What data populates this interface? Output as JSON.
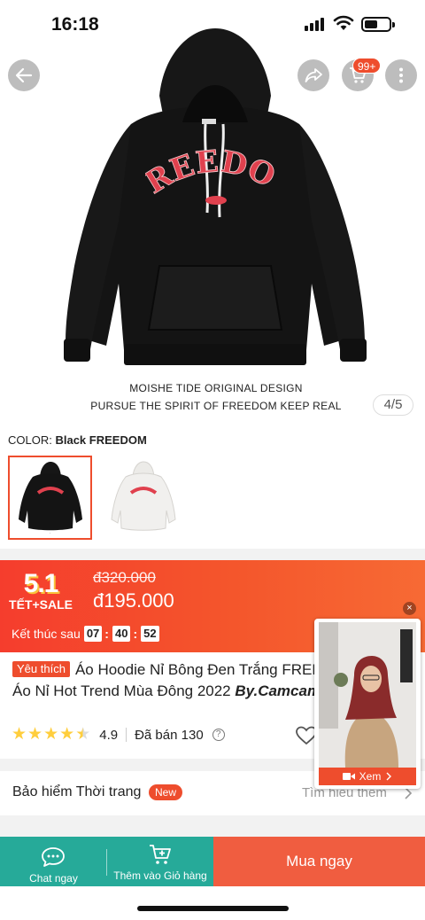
{
  "status_bar": {
    "time": "16:18"
  },
  "hero": {
    "cart_badge": "99+",
    "garment_print": "FREEDOM",
    "caption_line1": "MOISHE TIDE ORIGINAL DESIGN",
    "caption_line2": "PURSUE THE SPIRIT OF FREEDOM KEEP REAL",
    "image_counter": "4/5"
  },
  "color": {
    "label": "COLOR:",
    "selected": "Black FREEDOM"
  },
  "sale": {
    "logo_top": "5.1",
    "logo_bottom": "TẾT+SALE",
    "original_price": "đ320.000",
    "price": "đ195.000",
    "ends_label": "Kết thúc sau",
    "hours": "07",
    "minutes": "40",
    "seconds": "52"
  },
  "product": {
    "favorite_tag": "Yêu thích",
    "title_line1": "Áo Hoodie Nỉ Bông Đen Trắng FREEDOM",
    "title_line2_start": "Áo Nỉ Hot Trend Mùa Đông 2022 ",
    "title_brand": "By.Camcam",
    "rating": "4.9",
    "stars": 4.5,
    "sold": "Đã bán 130"
  },
  "insurance": {
    "label": "Bảo hiểm Thời trang",
    "new_tag": "New",
    "more": "Tìm hiểu thêm"
  },
  "video": {
    "watch_label": "Xem"
  },
  "bottom_bar": {
    "chat_label": "Chat ngay",
    "add_to_cart_label": "Thêm vào Giỏ hàng",
    "buy_now_label": "Mua ngay"
  },
  "colors": {
    "accent": "#ee4d2d",
    "teal": "#26aa99",
    "star": "#ffce3d"
  }
}
